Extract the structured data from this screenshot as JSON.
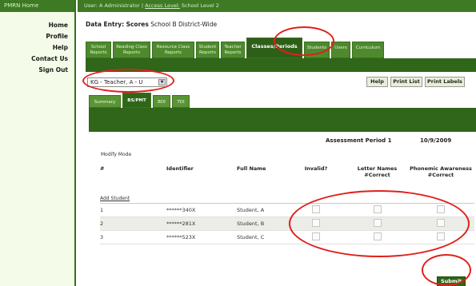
{
  "sidebar": {
    "header": "PMRN Home",
    "links": [
      "Home",
      "Profile",
      "Help",
      "Contact Us",
      "Sign Out"
    ]
  },
  "topbar": {
    "user": "User: A Administrator",
    "separator": "|",
    "access_link": "Access Level:",
    "access_value": "School Level 2"
  },
  "page": {
    "title_prefix": "Data Entry:",
    "title_bold": "Scores",
    "title_suffix": "School B District-Wide"
  },
  "tabs": [
    {
      "line1": "School",
      "line2": "Reports"
    },
    {
      "line1": "Reading Class",
      "line2": "Reports"
    },
    {
      "line1": "Resource Class",
      "line2": "Reports"
    },
    {
      "line1": "Student",
      "line2": "Reports"
    },
    {
      "line1": "Teacher",
      "line2": "Reports"
    },
    {
      "line1": "Classes/Periods",
      "line2": ""
    },
    {
      "line1": "Students",
      "line2": ""
    },
    {
      "line1": "Users",
      "line2": ""
    },
    {
      "line1": "Curriculum",
      "line2": ""
    }
  ],
  "class_select": {
    "value": "KG - Teacher, A - U"
  },
  "buttons": {
    "help": "Help",
    "print_list": "Print List",
    "print_labels": "Print Labels"
  },
  "subtabs": [
    "Summary",
    "BS/PMT",
    "BDI",
    "TDI"
  ],
  "assessment": {
    "period": "Assessment Period 1",
    "date": "10/9/2009"
  },
  "mode": "Modify Mode",
  "table": {
    "headers": [
      "#",
      "Identifier",
      "Full Name",
      "Invalid?",
      "Letter Names #Correct",
      "Phonemic Awareness #Correct"
    ],
    "add_student": "Add Student",
    "rows": [
      {
        "num": "1",
        "id": "******340X",
        "name": "Student, A"
      },
      {
        "num": "2",
        "id": "******281X",
        "name": "Student, B"
      },
      {
        "num": "3",
        "id": "******523X",
        "name": "Student, C"
      }
    ]
  },
  "submit": "Submit",
  "colors": {
    "brand_green": "#3d7a23",
    "dark_green": "#2f6619",
    "callout_red": "#e0201a"
  }
}
